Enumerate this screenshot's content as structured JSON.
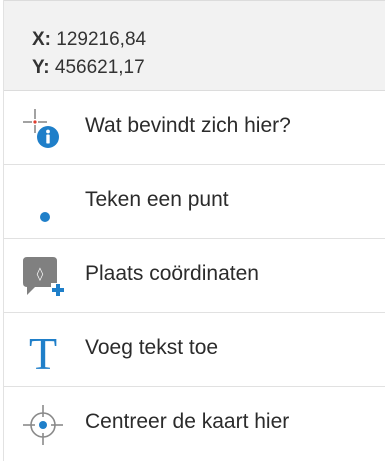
{
  "coordinates": {
    "x_label": "X:",
    "x_value": "129216,84",
    "y_label": "Y:",
    "y_value": "456621,17"
  },
  "menu": {
    "items": [
      {
        "label": "Wat bevindt zich hier?",
        "icon": "info-crosshair-icon"
      },
      {
        "label": "Teken een punt",
        "icon": "point-icon"
      },
      {
        "label": "Plaats coördinaten",
        "icon": "place-coordinates-icon"
      },
      {
        "label": "Voeg tekst toe",
        "icon": "text-icon"
      },
      {
        "label": "Centreer de kaart hier",
        "icon": "center-map-icon"
      }
    ]
  },
  "colors": {
    "accent": "#1f7fc9",
    "icon_gray": "#7a7a7a",
    "header_bg": "#f2f2f2"
  }
}
